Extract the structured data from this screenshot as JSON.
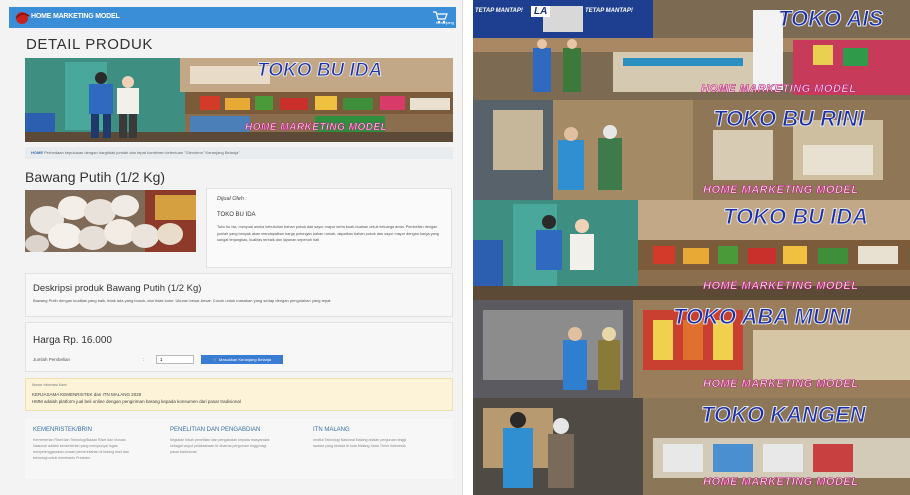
{
  "header": {
    "brand": "HOME MARKETING MODEL",
    "cart_label": "Keranjang"
  },
  "page_title": "DETAIL PRODUK",
  "banner": {
    "shop_sign": "TOKO BU IDA",
    "watermark": "HOME MARKETING MODEL"
  },
  "breadcrumb": {
    "home": "HOME",
    "text": "Perbedaan keputusan dengan hargtidak jumlah dan tepat komitmen ketentuan \"Glendenn\" Keranjang Belanja\""
  },
  "product": {
    "title": "Bawang Putih (1/2 Kg)",
    "sold_by_label": "Dijual Oleh :",
    "seller_name": "TOKO BU IDA",
    "seller_desc": "Toko bu ida, menyuai aneka kebutuhan bahan pokok dan sayur mayur serta buah-buahan untuk keluarga anda. Pembelian dengan jumlah yang banyak akan mendapatkan harga potongan bahan rumah, dapatkan bahan pokok dan sayur mayur dengan harga yang sangat terjangkau, kualitas terbaik dan layanan sepenuh hati"
  },
  "description": {
    "title": "Deskripsi produk Bawang Putih (1/2 Kg)",
    "text": "Bawang Putih dengan kualitas yang baik, tidak ada yang busuk, dan tidak kotor. Ukuran besar-besar. Cocok untuk masakan yang sedap dengan pengolahan yang tepat"
  },
  "purchase": {
    "price": "Harga Rp. 16.000",
    "qty_label": "Jumlah Pembelian",
    "qty_colon": ":",
    "qty_value": "1",
    "add_button": "Masukkan Keranjang Belanja"
  },
  "notice": {
    "small": "Nomor Informasi Kami",
    "line1": "KERJASAMA KEMENRISTEK dan ITN MALANG 2020",
    "line2": "HMM adalah platform jual beli online dengan pengiriman barang kepada konsumen dari pasar tradisional"
  },
  "footer": [
    {
      "heading": "KEMENRISTEK/BRIN",
      "text": "Kementerian Riset dan Teknologi/Badan Riset dan Inovasi Nasional adalah kementerian yang mempunyai tugas menyelenggarakan urusan pemerintahan di bidang riset dan teknologi untuk membantu Presiden"
    },
    {
      "heading": "PENELITIAN DAN PENGABDIAN",
      "text": "Kegiatan hibah penelitian dan pengabdian kepada masyarakat sebagai wujud pelaksanaan tri dharma perguruan tinggi bagi pasar tradisional"
    },
    {
      "heading": "ITN MALANG",
      "text": "Institut Teknologi Nasional Malang adalah perguruan tinggi swasta yang berada di kota Malang Jawa Timur Indonesia"
    }
  ],
  "collage": {
    "signs": [
      "TOKO AIS",
      "TOKO BU RINI",
      "TOKO BU IDA",
      "TOKO ABA MUNI",
      "TOKO KANGEN"
    ],
    "watermark": "HOME MARKETING MODEL",
    "top_banner_left": "TETAP MANTAP!",
    "top_banner_right": "TETAP MANTAP!",
    "top_banner_logo": "LA"
  },
  "colors": {
    "topbar": "#3a8ed8",
    "sign_text": "#1d2fa8",
    "watermark": "#b81f77",
    "button": "#3a7cd3",
    "notice_bg": "#fdf3d9"
  }
}
